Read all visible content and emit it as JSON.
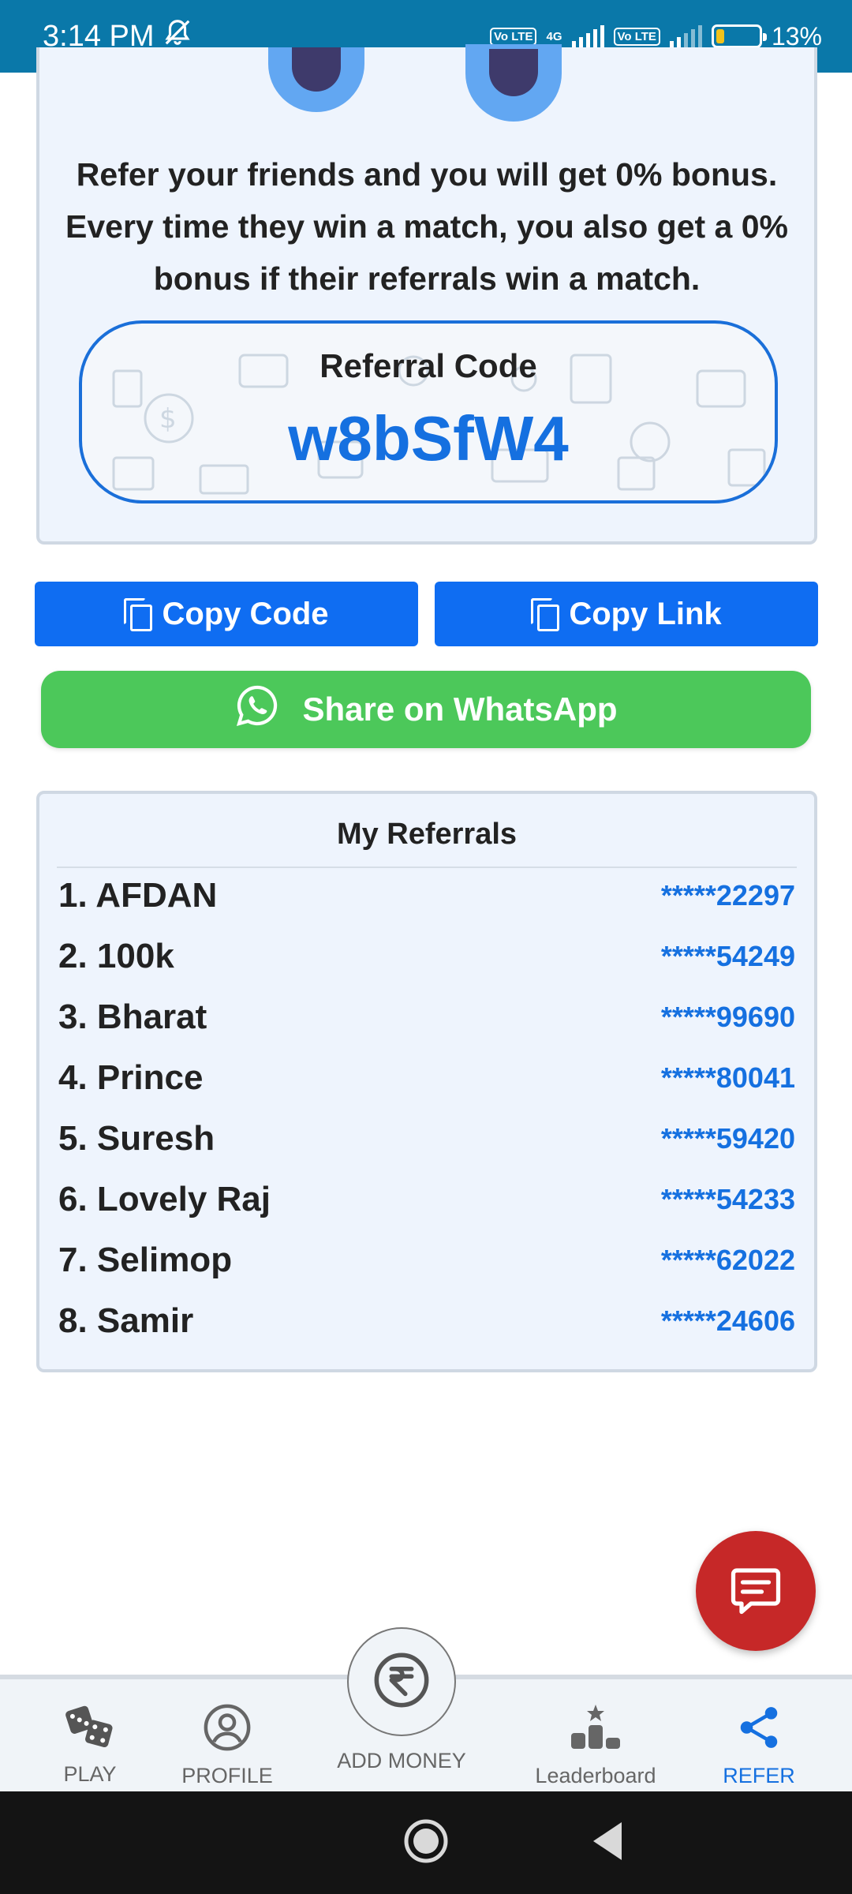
{
  "status_bar": {
    "time": "3:14 PM",
    "network": "4G",
    "volte_1": "Vo LTE",
    "volte_2": "Vo LTE",
    "battery": "13%"
  },
  "referral": {
    "description": "Refer your friends and you will get 0% bonus. Every time they win a match, you also get a 0% bonus if their referrals win a match.",
    "code_label": "Referral Code",
    "code": "w8bSfW4"
  },
  "actions": {
    "copy_code": "Copy Code",
    "copy_link": "Copy Link",
    "share_whatsapp": "Share on WhatsApp"
  },
  "referrals": {
    "title": "My Referrals",
    "items": [
      {
        "name": "1. AFDAN",
        "phone": "*****22297"
      },
      {
        "name": "2. 100k",
        "phone": "*****54249"
      },
      {
        "name": "3. Bharat",
        "phone": "*****99690"
      },
      {
        "name": "4. Prince",
        "phone": "*****80041"
      },
      {
        "name": "5. Suresh",
        "phone": "*****59420"
      },
      {
        "name": "6. Lovely Raj",
        "phone": "*****54233"
      },
      {
        "name": "7. Selimop",
        "phone": "*****62022"
      },
      {
        "name": "8. Samir",
        "phone": "*****24606"
      }
    ]
  },
  "bottom_nav": {
    "play": "PLAY",
    "profile": "PROFILE",
    "add_money": "ADD MONEY",
    "leaderboard": "Leaderboard",
    "refer": "REFER",
    "active": "REFER",
    "active_color": "#1570e0"
  },
  "colors": {
    "status_bar": "#0a78a9",
    "primary_blue": "#0f6df2",
    "whatsapp_green": "#4cc85a",
    "chat_red": "#c62828"
  }
}
